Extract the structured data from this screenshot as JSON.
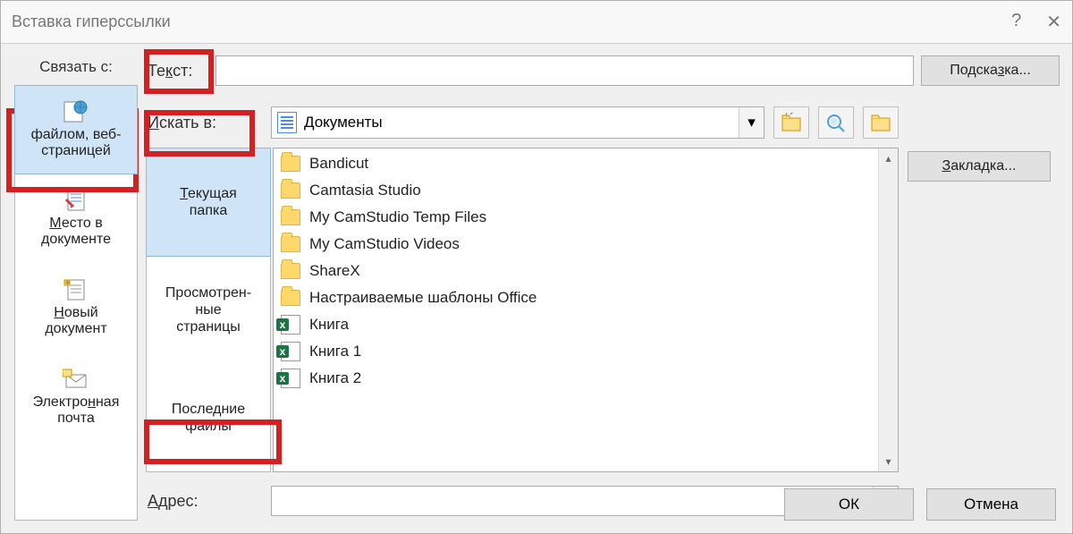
{
  "titlebar": {
    "title": "Вставка гиперссылки"
  },
  "linkto": {
    "label": "Связать с:",
    "items": [
      {
        "line1": "файлом, веб-",
        "line2": "страницей",
        "under1": "в",
        "selected": true
      },
      {
        "line1": "Место в",
        "line2": "документе",
        "under1": "М"
      },
      {
        "line1": "Новый",
        "line2": "документ",
        "under1": "Н"
      },
      {
        "line1": "Электронная",
        "line2": "почта",
        "under1": "н"
      }
    ]
  },
  "text_row": {
    "label": "Текст:",
    "value": ""
  },
  "right_buttons": {
    "screentip": "Подсказка...",
    "bookmark": "Закладка..."
  },
  "lookin": {
    "label": "Искать в:",
    "current": "Документы"
  },
  "subnav": {
    "items": [
      {
        "line1": "Текущая",
        "line2": "папка",
        "selected": true
      },
      {
        "line1": "Просмотрен-",
        "line2": "ные",
        "line3": "страницы"
      },
      {
        "line1": "Последние",
        "line2": "файлы"
      }
    ]
  },
  "files": [
    {
      "name": "Bandicut",
      "type": "folder"
    },
    {
      "name": "Camtasia Studio",
      "type": "folder"
    },
    {
      "name": "My CamStudio Temp Files",
      "type": "folder"
    },
    {
      "name": "My CamStudio Videos",
      "type": "folder"
    },
    {
      "name": "ShareX",
      "type": "folder"
    },
    {
      "name": "Настраиваемые шаблоны Office",
      "type": "folder"
    },
    {
      "name": "Книга",
      "type": "excel"
    },
    {
      "name": "Книга 1",
      "type": "excel"
    },
    {
      "name": "Книга 2",
      "type": "excel"
    }
  ],
  "address": {
    "label": "Адрес:",
    "value": ""
  },
  "footer": {
    "ok": "ОК",
    "cancel": "Отмена"
  }
}
